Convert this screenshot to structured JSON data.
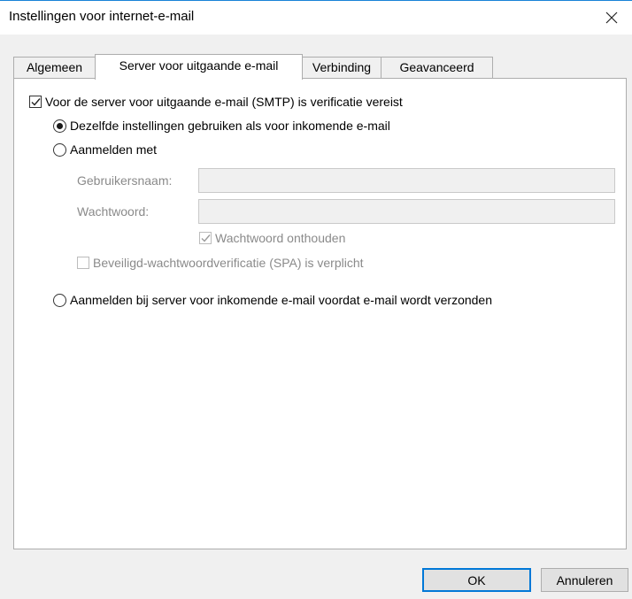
{
  "window": {
    "title": "Instellingen voor internet-e-mail",
    "close_icon": "close-icon"
  },
  "tabs": [
    {
      "label": "Algemeen",
      "active": false
    },
    {
      "label": "Server voor uitgaande e-mail",
      "active": true
    },
    {
      "label": "Verbinding",
      "active": false
    },
    {
      "label": "Geavanceerd",
      "active": false
    }
  ],
  "outgoing": {
    "smtp_auth_label": "Voor de server voor uitgaande e-mail (SMTP) is verificatie vereist",
    "smtp_auth_checked": true,
    "option_same_label": "Dezelfde instellingen gebruiken als voor inkomende e-mail",
    "option_same_selected": true,
    "option_login_label": "Aanmelden met",
    "option_login_selected": false,
    "username_label": "Gebruikersnaam:",
    "username_value": "",
    "password_label": "Wachtwoord:",
    "password_value": "",
    "remember_label": "Wachtwoord onthouden",
    "remember_checked": true,
    "spa_label": "Beveiligd-wachtwoordverificatie (SPA) is verplicht",
    "spa_checked": false,
    "option_incoming_first_label": "Aanmelden bij server voor inkomende e-mail voordat e-mail wordt verzonden",
    "option_incoming_first_selected": false
  },
  "buttons": {
    "ok": "OK",
    "cancel": "Annuleren"
  },
  "colors": {
    "accent": "#0078d7",
    "disabled_text": "#8a8a8a"
  }
}
